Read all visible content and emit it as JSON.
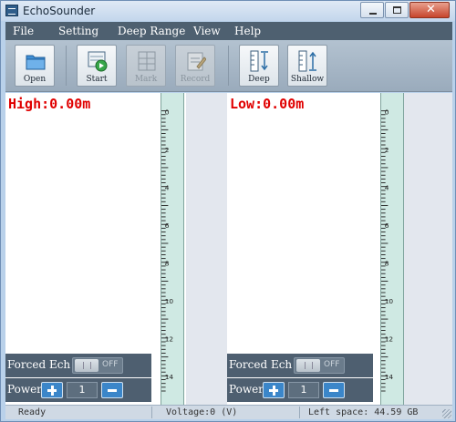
{
  "window": {
    "title": "EchoSounder"
  },
  "menu": [
    "File",
    "Setting",
    "Deep Range",
    "View",
    "Help"
  ],
  "toolbar": {
    "open": "Open",
    "start": "Start",
    "mark": "Mark",
    "record": "Record",
    "deep": "Deep",
    "shallow": "Shallow"
  },
  "left_panel": {
    "readout": "High:0.00m",
    "forced_label": "Forced Ech",
    "toggle_state": "OFF",
    "power_label": "Power",
    "power_value": "1"
  },
  "right_panel": {
    "readout": "Low:0.00m",
    "forced_label": "Forced Ech",
    "toggle_state": "OFF",
    "power_label": "Power",
    "power_value": "1"
  },
  "ruler_labels": [
    "0",
    "2",
    "4",
    "6",
    "8",
    "10",
    "12",
    "14"
  ],
  "status": {
    "ready": "Ready",
    "voltage": "Voltage:0 (V)",
    "left_space": "Left space: 44.59 GB"
  },
  "colors": {
    "readout": "#e00000",
    "menubar": "#4e6070",
    "ruler": "#cfe9e3",
    "power_button": "#3b86c9"
  },
  "icons": [
    "folder-icon",
    "play-chart-icon",
    "mark-grid-icon",
    "record-notepad-icon",
    "deep-ruler-icon",
    "shallow-ruler-icon"
  ]
}
